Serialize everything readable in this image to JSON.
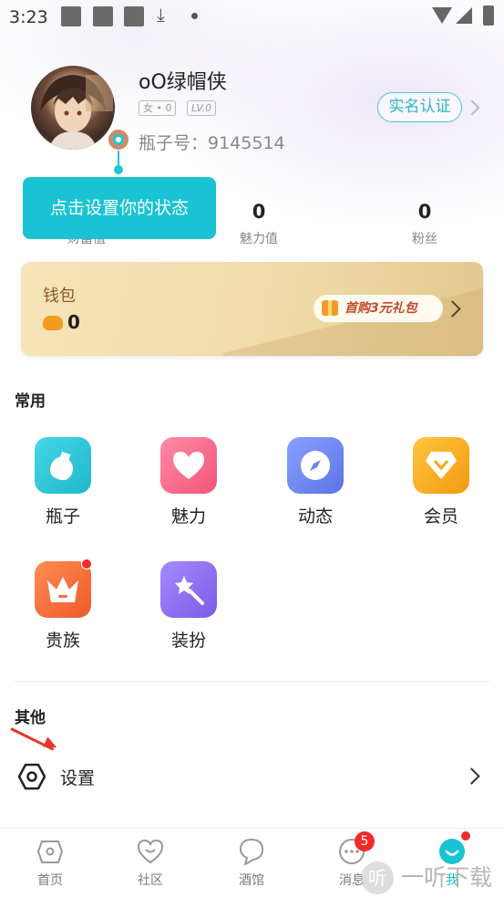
{
  "status_bar": {
    "time": "3:23"
  },
  "profile": {
    "username": "oO绿帽侠",
    "gender_tag": "女 • 0",
    "level_tag": "LV.0",
    "bottle_id": "瓶子号：9145514",
    "realname_button": "实名认证"
  },
  "tooltip": {
    "text": "点击设置你的状态"
  },
  "stats": [
    {
      "value": "0",
      "label": "财富值"
    },
    {
      "value": "0",
      "label": "魅力值"
    },
    {
      "value": "0",
      "label": "粉丝"
    }
  ],
  "wallet": {
    "title": "钱包",
    "coins": "0",
    "gift_label": "首购3元礼包"
  },
  "common": {
    "title": "常用",
    "items": [
      {
        "label": "瓶子",
        "color": "#27c6d8",
        "icon": "bottle-icon"
      },
      {
        "label": "魅力",
        "color": "#f56b8a",
        "icon": "heart-icon"
      },
      {
        "label": "动态",
        "color": "#6a86f0",
        "icon": "compass-icon"
      },
      {
        "label": "会员",
        "color": "#f7a81b",
        "icon": "diamond-icon"
      },
      {
        "label": "贵族",
        "color": "#f56e3c",
        "icon": "crown-icon",
        "dot": true
      },
      {
        "label": "装扮",
        "color": "#8a6cf0",
        "icon": "wand-icon"
      }
    ]
  },
  "other": {
    "title": "其他",
    "settings_label": "设置"
  },
  "nav": [
    {
      "label": "首页",
      "icon": "home-icon"
    },
    {
      "label": "社区",
      "icon": "community-icon"
    },
    {
      "label": "酒馆",
      "icon": "tavern-icon"
    },
    {
      "label": "消息",
      "icon": "message-icon",
      "badge": "5"
    },
    {
      "label": "我",
      "icon": "me-icon",
      "active": true
    }
  ],
  "watermark": {
    "text": "一听下载",
    "glyph": "听"
  },
  "colors": {
    "accent": "#19c3d4",
    "badge_red": "#f12b2b"
  }
}
